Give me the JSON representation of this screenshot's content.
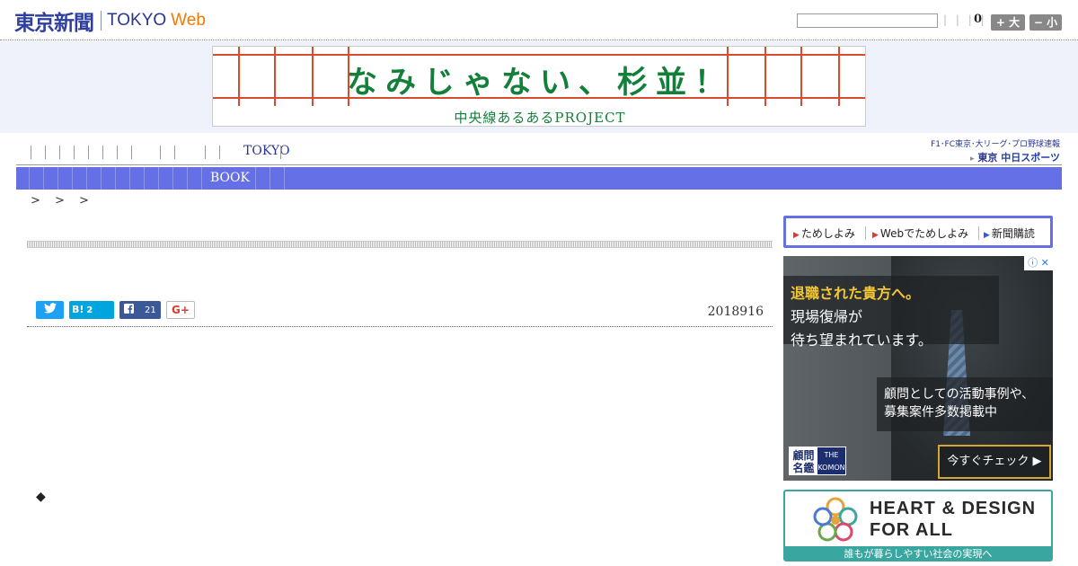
{
  "header": {
    "logo_jp": "東京新聞",
    "logo_tokyo": "TOKYO",
    "logo_web": "Web",
    "search_value": "",
    "tiny_links": "| | | |",
    "count": "0",
    "font_larger": "+ 大",
    "font_smaller": "− 小"
  },
  "banner": {
    "title": "なみじゃない、杉並！",
    "subtitle": "中央線あるあるPROJECT"
  },
  "nav": {
    "primary_label": "TOKYO",
    "secondary_label": "BOOK",
    "chunichi_top": "F1･FC東京･大リーグ･プロ野球速報",
    "chunichi_prefix": "東京",
    "chunichi_name": "中日スポーツ"
  },
  "breadcrumb": "> > >",
  "article": {
    "date": "2018916",
    "hatena_label": "B!",
    "hatena_count": "2",
    "facebook_count": "21",
    "gplus_label": "G+",
    "diamond": "◆"
  },
  "sidebar": {
    "links": [
      "ためしよみ",
      "Webでためしよみ",
      "新聞購読"
    ],
    "ad1": {
      "headline": "退職された貴方へ。",
      "line2": "現場復帰が",
      "line3": "待ち望まれています。",
      "body1": "顧問としての活動事例や、",
      "body2": "募集案件多数掲載中",
      "logo_a": "顧問名鑑",
      "logo_b": "THE KOMON",
      "cta": "今すぐチェック ▶"
    },
    "ad2": {
      "line1": "HEART & DESIGN",
      "line2": "FOR ALL",
      "strip": "誰もが暮らしやすい社会の実現へ"
    }
  },
  "colors": {
    "nav_bar": "#6670e6",
    "brand_blue": "#2a3590",
    "web_orange": "#ef7a00",
    "banner_green": "#13803a",
    "banner_red": "#d84b2c"
  }
}
